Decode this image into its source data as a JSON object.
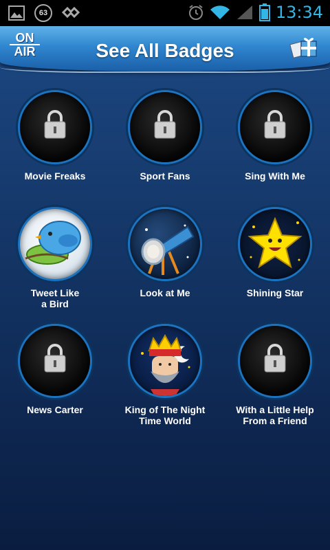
{
  "status_bar": {
    "notification_count": "63",
    "time": "13:34",
    "icons": [
      "gallery-icon",
      "notification-count-icon",
      "sync-icon",
      "alarm-icon",
      "wifi-icon",
      "signal-icon",
      "battery-icon"
    ]
  },
  "header": {
    "logo_line1": "ON",
    "logo_line2": "AIR",
    "title": "See All Badges",
    "right_icon": "gift-icon"
  },
  "badges": [
    {
      "label": "Movie Freaks",
      "locked": true
    },
    {
      "label": "Sport Fans",
      "locked": true
    },
    {
      "label": "Sing With Me",
      "locked": true
    },
    {
      "label": "Tweet Like\na Bird",
      "locked": false,
      "icon": "bird-icon"
    },
    {
      "label": "Look at Me",
      "locked": false,
      "icon": "telescope-icon"
    },
    {
      "label": "Shining Star",
      "locked": false,
      "icon": "star-icon"
    },
    {
      "label": "News Carter",
      "locked": true
    },
    {
      "label": "King of The Night\nTime World",
      "locked": false,
      "icon": "king-icon"
    },
    {
      "label": "With a Little Help\nFrom a Friend",
      "locked": true
    }
  ],
  "colors": {
    "accent": "#33b5e5",
    "header": "#2f86cf",
    "ring": "#1c73c0"
  }
}
